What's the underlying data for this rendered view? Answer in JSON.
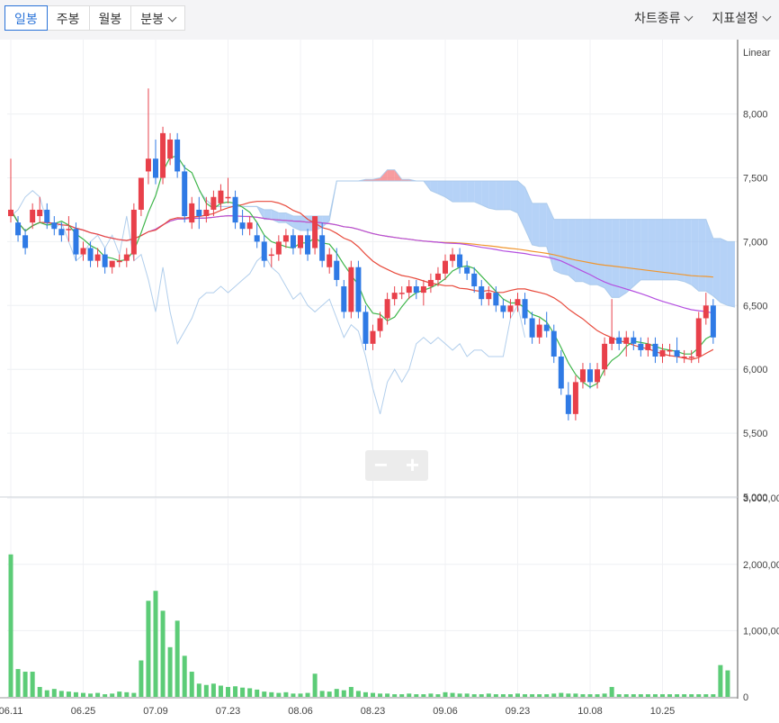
{
  "toolbar": {
    "tabs": [
      {
        "label": "일봉",
        "active": true
      },
      {
        "label": "주봉",
        "active": false
      },
      {
        "label": "월봉",
        "active": false
      },
      {
        "label": "분봉",
        "active": false
      }
    ],
    "chart_type_menu": "차트종류",
    "indicator_menu": "지표설정"
  },
  "zoom": {
    "minus": "−",
    "plus": "+"
  },
  "colors": {
    "up": "#e8404a",
    "down": "#2f7ae5",
    "volume": "#5ccc77",
    "ma5": "#3fb64b",
    "ma20": "#e84a3c",
    "ma60": "#b44fe0",
    "ma120": "#f0962e",
    "cloud_bull": "#f47b7f",
    "cloud_bear": "#9cc3f4",
    "span": "#a9c9ea"
  },
  "chart_data": {
    "type": "candlestick",
    "scale_label": "Linear",
    "price_ticks": [
      "5,000",
      "5,500",
      "6,000",
      "6,500",
      "7,000",
      "7,500",
      "8,000"
    ],
    "price_tick_values": [
      5000,
      5500,
      6000,
      6500,
      7000,
      7500,
      8000
    ],
    "volume_ticks": [
      "0",
      "1,000,00",
      "2,000,00",
      "3,000,00"
    ],
    "volume_tick_values": [
      0,
      1000000,
      2000000,
      3000000
    ],
    "x_labels": [
      "06.11",
      "06.25",
      "07.09",
      "07.23",
      "08.06",
      "08.23",
      "09.06",
      "09.23",
      "10.08",
      "10.25"
    ],
    "x_label_index": [
      0,
      10,
      20,
      30,
      40,
      50,
      60,
      70,
      80,
      90
    ],
    "ohlc": [
      [
        7200,
        7650,
        7150,
        7250
      ],
      [
        7150,
        7200,
        7000,
        7050
      ],
      [
        7050,
        7100,
        6900,
        6950
      ],
      [
        7150,
        7300,
        7100,
        7250
      ],
      [
        7200,
        7350,
        7150,
        7250
      ],
      [
        7250,
        7300,
        7100,
        7150
      ],
      [
        7150,
        7200,
        7050,
        7100
      ],
      [
        7100,
        7150,
        7000,
        7050
      ],
      [
        7100,
        7200,
        7000,
        7100
      ],
      [
        7100,
        7150,
        6850,
        6900
      ],
      [
        6900,
        7000,
        6850,
        6950
      ],
      [
        6950,
        7000,
        6800,
        6850
      ],
      [
        6850,
        6950,
        6800,
        6900
      ],
      [
        6900,
        6950,
        6750,
        6800
      ],
      [
        6800,
        6850,
        6750,
        6850
      ],
      [
        6850,
        6900,
        6800,
        6850
      ],
      [
        6850,
        6950,
        6800,
        6900
      ],
      [
        6900,
        7300,
        6850,
        7250
      ],
      [
        7250,
        7500,
        7200,
        7500
      ],
      [
        7550,
        8200,
        7450,
        7650
      ],
      [
        7650,
        7800,
        7450,
        7500
      ],
      [
        7500,
        7900,
        7450,
        7850
      ],
      [
        7650,
        7850,
        7600,
        7800
      ],
      [
        7800,
        7850,
        7500,
        7550
      ],
      [
        7550,
        7600,
        7150,
        7200
      ],
      [
        7150,
        7350,
        7100,
        7300
      ],
      [
        7250,
        7350,
        7100,
        7200
      ],
      [
        7200,
        7350,
        7150,
        7250
      ],
      [
        7250,
        7400,
        7200,
        7350
      ],
      [
        7300,
        7450,
        7250,
        7400
      ],
      [
        7350,
        7500,
        7300,
        7350
      ],
      [
        7350,
        7400,
        7100,
        7150
      ],
      [
        7150,
        7250,
        7050,
        7100
      ],
      [
        7100,
        7200,
        7050,
        7150
      ],
      [
        7050,
        7150,
        6950,
        7000
      ],
      [
        7000,
        7050,
        6800,
        6850
      ],
      [
        6900,
        6950,
        6800,
        6900
      ],
      [
        6900,
        7050,
        6850,
        7000
      ],
      [
        7000,
        7100,
        6950,
        7050
      ],
      [
        7050,
        7100,
        6900,
        6950
      ],
      [
        6950,
        7050,
        6900,
        7050
      ],
      [
        7050,
        7100,
        6850,
        6900
      ],
      [
        6950,
        7200,
        6900,
        7200
      ],
      [
        7050,
        7150,
        6800,
        6850
      ],
      [
        6800,
        6950,
        6750,
        6900
      ],
      [
        6850,
        6950,
        6650,
        6700
      ],
      [
        6650,
        6700,
        6400,
        6450
      ],
      [
        6450,
        6850,
        6400,
        6800
      ],
      [
        6800,
        6850,
        6400,
        6450
      ],
      [
        6450,
        6500,
        6150,
        6200
      ],
      [
        6200,
        6350,
        6150,
        6300
      ],
      [
        6300,
        6450,
        6250,
        6400
      ],
      [
        6400,
        6600,
        6350,
        6550
      ],
      [
        6550,
        6650,
        6500,
        6600
      ],
      [
        6600,
        6650,
        6550,
        6600
      ],
      [
        6600,
        6700,
        6550,
        6650
      ],
      [
        6650,
        6700,
        6550,
        6600
      ],
      [
        6600,
        6700,
        6500,
        6650
      ],
      [
        6650,
        6750,
        6600,
        6700
      ],
      [
        6700,
        6800,
        6650,
        6750
      ],
      [
        6750,
        6900,
        6700,
        6850
      ],
      [
        6850,
        6950,
        6800,
        6900
      ],
      [
        6900,
        6950,
        6750,
        6800
      ],
      [
        6800,
        6850,
        6700,
        6750
      ],
      [
        6750,
        6800,
        6600,
        6650
      ],
      [
        6650,
        6700,
        6500,
        6550
      ],
      [
        6550,
        6650,
        6500,
        6600
      ],
      [
        6600,
        6650,
        6450,
        6500
      ],
      [
        6500,
        6550,
        6400,
        6450
      ],
      [
        6450,
        6550,
        6400,
        6500
      ],
      [
        6500,
        6600,
        6450,
        6550
      ],
      [
        6550,
        6600,
        6350,
        6400
      ],
      [
        6400,
        6450,
        6200,
        6250
      ],
      [
        6250,
        6400,
        6200,
        6350
      ],
      [
        6350,
        6450,
        6250,
        6300
      ],
      [
        6300,
        6350,
        6050,
        6100
      ],
      [
        6100,
        6150,
        5800,
        5850
      ],
      [
        5800,
        5900,
        5600,
        5650
      ],
      [
        5650,
        5950,
        5600,
        5900
      ],
      [
        5900,
        6050,
        5850,
        6000
      ],
      [
        6000,
        6050,
        5850,
        5900
      ],
      [
        5900,
        6050,
        5850,
        6000
      ],
      [
        6000,
        6250,
        5950,
        6200
      ],
      [
        6200,
        6550,
        6150,
        6250
      ],
      [
        6250,
        6300,
        6150,
        6200
      ],
      [
        6200,
        6300,
        6100,
        6250
      ],
      [
        6250,
        6300,
        6150,
        6200
      ],
      [
        6200,
        6250,
        6100,
        6150
      ],
      [
        6150,
        6250,
        6100,
        6200
      ],
      [
        6200,
        6250,
        6050,
        6100
      ],
      [
        6100,
        6200,
        6050,
        6150
      ],
      [
        6150,
        6200,
        6100,
        6150
      ],
      [
        6150,
        6250,
        6050,
        6100
      ],
      [
        6100,
        6150,
        6050,
        6100
      ],
      [
        6100,
        6150,
        6050,
        6100
      ],
      [
        6100,
        6450,
        6050,
        6400
      ],
      [
        6400,
        6600,
        6350,
        6500
      ],
      [
        6500,
        6550,
        6200,
        6250
      ]
    ],
    "volume": [
      2150000,
      420000,
      380000,
      380000,
      150000,
      100000,
      120000,
      90000,
      80000,
      70000,
      60000,
      50000,
      60000,
      40000,
      50000,
      80000,
      70000,
      60000,
      550000,
      1450000,
      1600000,
      1300000,
      750000,
      1150000,
      620000,
      380000,
      200000,
      180000,
      200000,
      170000,
      150000,
      160000,
      140000,
      130000,
      110000,
      80000,
      70000,
      60000,
      70000,
      50000,
      50000,
      60000,
      350000,
      90000,
      80000,
      120000,
      100000,
      150000,
      90000,
      70000,
      60000,
      50000,
      50000,
      40000,
      40000,
      50000,
      40000,
      40000,
      50000,
      40000,
      70000,
      60000,
      50000,
      50000,
      40000,
      40000,
      50000,
      40000,
      40000,
      40000,
      50000,
      40000,
      40000,
      40000,
      40000,
      50000,
      60000,
      50000,
      50000,
      40000,
      40000,
      40000,
      50000,
      150000,
      40000,
      40000,
      40000,
      40000,
      40000,
      40000,
      40000,
      40000,
      40000,
      40000,
      40000,
      40000,
      40000,
      40000,
      480000,
      400000
    ]
  }
}
